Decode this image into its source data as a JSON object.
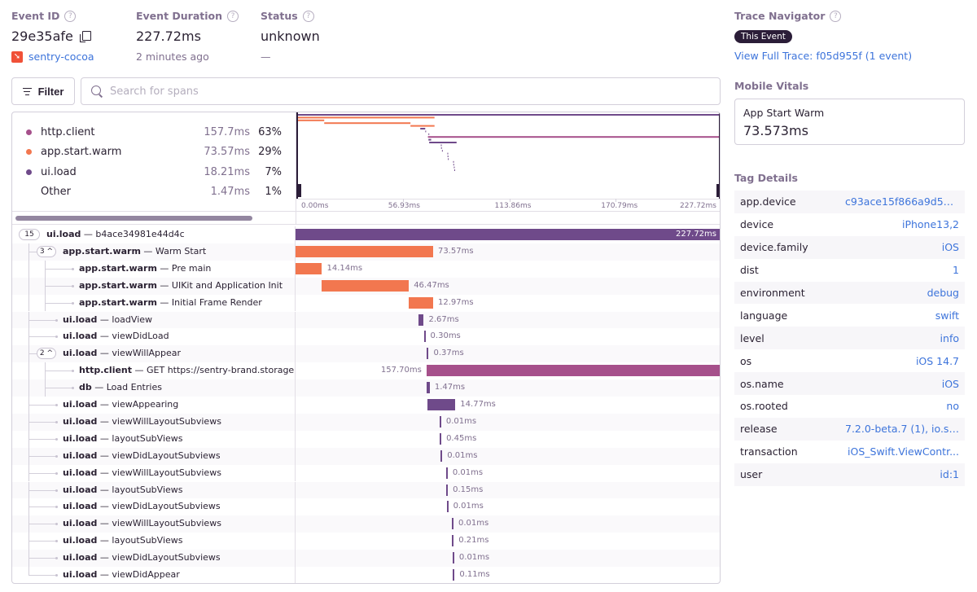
{
  "header": {
    "event_id": {
      "label": "Event ID",
      "value": "29e35afe",
      "project": "sentry-cocoa"
    },
    "event_duration": {
      "label": "Event Duration",
      "value": "227.72ms",
      "sub": "2 minutes ago"
    },
    "status": {
      "label": "Status",
      "value": "unknown",
      "sub": "—"
    }
  },
  "toolbar": {
    "filter_label": "Filter",
    "search_placeholder": "Search for spans",
    "search_value": ""
  },
  "ops_breakdown": [
    {
      "op": "http.client",
      "duration": "157.7ms",
      "percent": "63%",
      "color": "#a6508b"
    },
    {
      "op": "app.start.warm",
      "duration": "73.57ms",
      "percent": "29%",
      "color": "#f2774f"
    },
    {
      "op": "ui.load",
      "duration": "18.21ms",
      "percent": "7%",
      "color": "#6f4a8a"
    },
    {
      "op": "Other",
      "duration": "1.47ms",
      "percent": "1%",
      "color": ""
    }
  ],
  "timeline": {
    "total_ms": 227.72,
    "ticks": [
      "0.00ms",
      "56.93ms",
      "113.86ms",
      "170.79ms",
      "227.72ms"
    ]
  },
  "spans": [
    {
      "op": "ui.load",
      "desc": "b4ace34981e44d4c",
      "depth": 0,
      "children": "15",
      "start": 0,
      "duration": 227.72,
      "label": "227.72ms",
      "color": "#6f4a8a"
    },
    {
      "op": "app.start.warm",
      "desc": "Warm Start",
      "depth": 1,
      "children": "3 ^",
      "start": 0,
      "duration": 73.57,
      "label": "73.57ms",
      "color": "#f2774f"
    },
    {
      "op": "app.start.warm",
      "desc": "Pre main",
      "depth": 2,
      "children": "",
      "start": 0,
      "duration": 14.14,
      "label": "14.14ms",
      "color": "#f2774f"
    },
    {
      "op": "app.start.warm",
      "desc": "UIKit and Application Init",
      "depth": 2,
      "children": "",
      "start": 14.14,
      "duration": 46.47,
      "label": "46.47ms",
      "color": "#f2774f"
    },
    {
      "op": "app.start.warm",
      "desc": "Initial Frame Render",
      "depth": 2,
      "children": "",
      "start": 60.61,
      "duration": 12.97,
      "label": "12.97ms",
      "color": "#f2774f"
    },
    {
      "op": "ui.load",
      "desc": "loadView",
      "depth": 1,
      "children": "",
      "start": 65.9,
      "duration": 2.67,
      "label": "2.67ms",
      "color": "#6f4a8a"
    },
    {
      "op": "ui.load",
      "desc": "viewDidLoad",
      "depth": 1,
      "children": "",
      "start": 68.6,
      "duration": 0.3,
      "label": "0.30ms",
      "color": "#6f4a8a"
    },
    {
      "op": "ui.load",
      "desc": "viewWillAppear",
      "depth": 1,
      "children": "2 ^",
      "start": 70.3,
      "duration": 0.37,
      "label": "0.37ms",
      "color": "#6f4a8a"
    },
    {
      "op": "http.client",
      "desc": "GET https://sentry-brand.storage.googleapis.com",
      "depth": 2,
      "children": "",
      "start": 70.02,
      "duration": 157.7,
      "label": "157.70ms",
      "color": "#a6508b"
    },
    {
      "op": "db",
      "desc": "Load Entries",
      "depth": 2,
      "children": "",
      "start": 70.3,
      "duration": 1.47,
      "label": "1.47ms",
      "color": "#6f4a8a"
    },
    {
      "op": "ui.load",
      "desc": "viewAppearing",
      "depth": 1,
      "children": "",
      "start": 70.7,
      "duration": 14.77,
      "label": "14.77ms",
      "color": "#6f4a8a"
    },
    {
      "op": "ui.load",
      "desc": "viewWillLayoutSubviews",
      "depth": 1,
      "children": "",
      "start": 77.0,
      "duration": 0.01,
      "label": "0.01ms",
      "color": "#6f4a8a"
    },
    {
      "op": "ui.load",
      "desc": "layoutSubViews",
      "depth": 1,
      "children": "",
      "start": 77.1,
      "duration": 0.45,
      "label": "0.45ms",
      "color": "#6f4a8a"
    },
    {
      "op": "ui.load",
      "desc": "viewDidLayoutSubviews",
      "depth": 1,
      "children": "",
      "start": 77.6,
      "duration": 0.01,
      "label": "0.01ms",
      "color": "#6f4a8a"
    },
    {
      "op": "ui.load",
      "desc": "viewWillLayoutSubviews",
      "depth": 1,
      "children": "",
      "start": 80.5,
      "duration": 0.01,
      "label": "0.01ms",
      "color": "#6f4a8a"
    },
    {
      "op": "ui.load",
      "desc": "layoutSubViews",
      "depth": 1,
      "children": "",
      "start": 80.6,
      "duration": 0.15,
      "label": "0.15ms",
      "color": "#6f4a8a"
    },
    {
      "op": "ui.load",
      "desc": "viewDidLayoutSubviews",
      "depth": 1,
      "children": "",
      "start": 80.8,
      "duration": 0.01,
      "label": "0.01ms",
      "color": "#6f4a8a"
    },
    {
      "op": "ui.load",
      "desc": "viewWillLayoutSubviews",
      "depth": 1,
      "children": "",
      "start": 83.6,
      "duration": 0.01,
      "label": "0.01ms",
      "color": "#6f4a8a"
    },
    {
      "op": "ui.load",
      "desc": "layoutSubViews",
      "depth": 1,
      "children": "",
      "start": 83.7,
      "duration": 0.21,
      "label": "0.21ms",
      "color": "#6f4a8a"
    },
    {
      "op": "ui.load",
      "desc": "viewDidLayoutSubviews",
      "depth": 1,
      "children": "",
      "start": 84.0,
      "duration": 0.01,
      "label": "0.01ms",
      "color": "#6f4a8a"
    },
    {
      "op": "ui.load",
      "desc": "viewDidAppear",
      "depth": 1,
      "children": "",
      "start": 84.2,
      "duration": 0.11,
      "label": "0.11ms",
      "color": "#6f4a8a"
    }
  ],
  "sidebar": {
    "trace_navigator": {
      "title": "Trace Navigator",
      "badge": "This Event",
      "link": "View Full Trace: f05d955f (1 event)"
    },
    "mobile_vitals": {
      "title": "Mobile Vitals",
      "name": "App Start Warm",
      "value": "73.573ms"
    },
    "tag_details": {
      "title": "Tag Details",
      "tags": [
        {
          "key": "app.device",
          "value": "c93ace15f866a9d50..."
        },
        {
          "key": "device",
          "value": "iPhone13,2"
        },
        {
          "key": "device.family",
          "value": "iOS"
        },
        {
          "key": "dist",
          "value": "1"
        },
        {
          "key": "environment",
          "value": "debug"
        },
        {
          "key": "language",
          "value": "swift"
        },
        {
          "key": "level",
          "value": "info"
        },
        {
          "key": "os",
          "value": "iOS 14.7"
        },
        {
          "key": "os.name",
          "value": "iOS"
        },
        {
          "key": "os.rooted",
          "value": "no"
        },
        {
          "key": "release",
          "value": "7.2.0-beta.7 (1), io.se..."
        },
        {
          "key": "transaction",
          "value": "iOS_Swift.ViewContr..."
        },
        {
          "key": "user",
          "value": "id:1"
        }
      ]
    }
  }
}
